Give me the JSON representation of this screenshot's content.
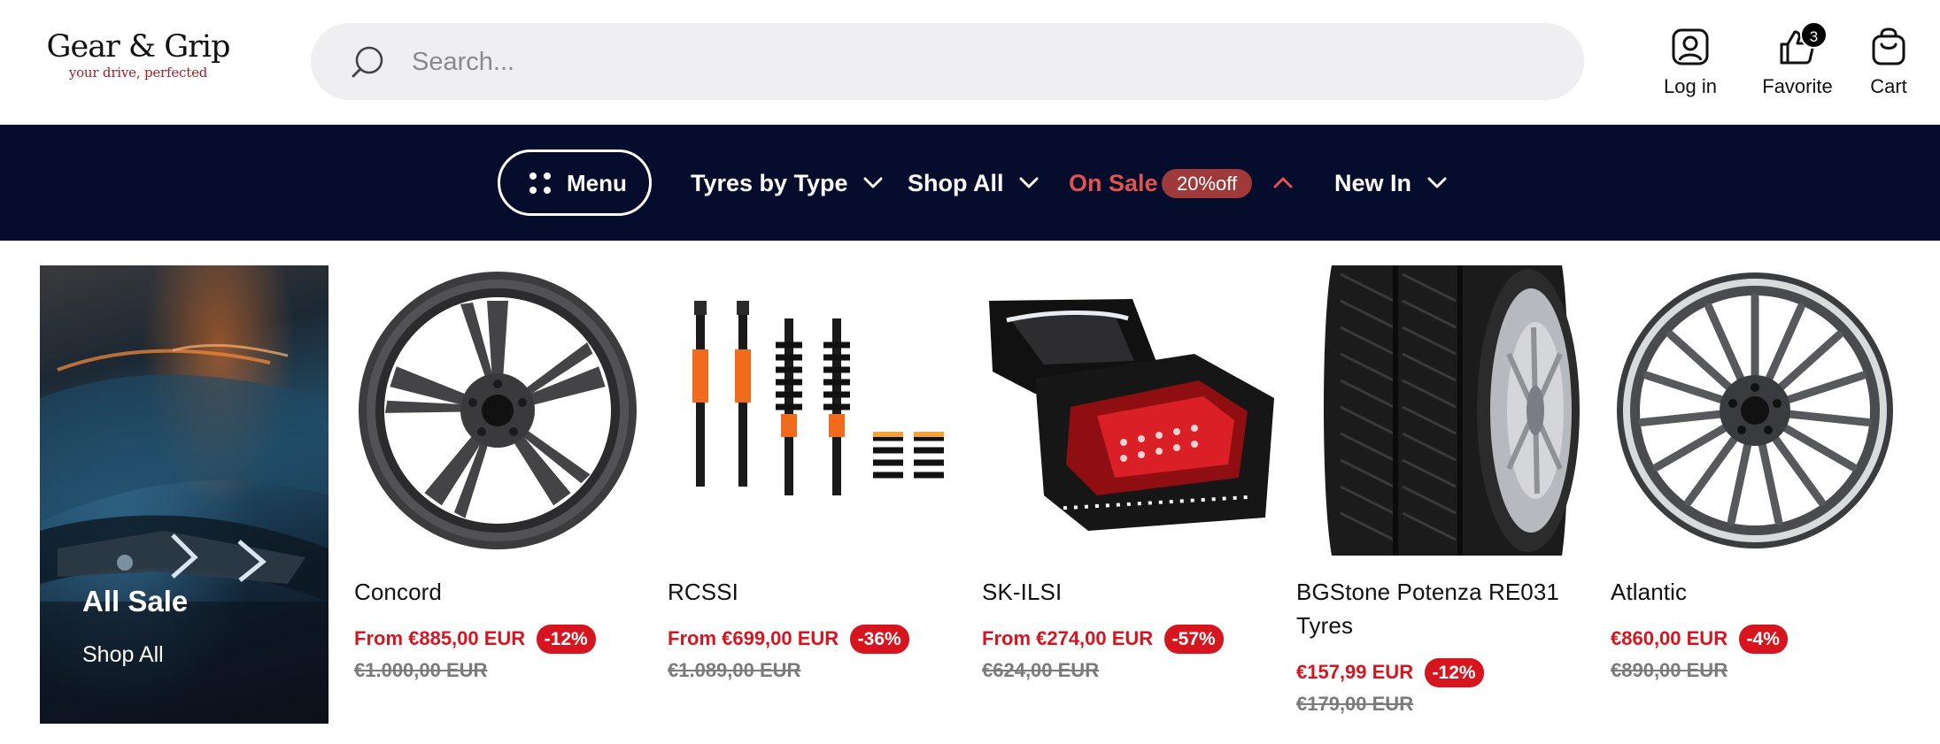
{
  "header": {
    "logo_name": "Gear & Grip",
    "logo_tagline": "your drive, perfected",
    "search_placeholder": "Search...",
    "actions": {
      "login": "Log in",
      "favorite": "Favorite",
      "favorite_count": "3",
      "cart": "Cart"
    }
  },
  "nav": {
    "menu": "Menu",
    "items": {
      "tyres": "Tyres by Type",
      "shop_all": "Shop All",
      "on_sale": "On Sale",
      "sale_badge": "20%off",
      "new_in": "New In"
    },
    "sale_color": "#e1534e"
  },
  "promo": {
    "title": "All Sale",
    "link": "Shop All"
  },
  "products": [
    {
      "name": "Concord",
      "price": "From €885,00 EUR",
      "discount": "-12%",
      "old_price": "€1.000,00 EUR",
      "image_icon": "alloy-wheel-five-spoke"
    },
    {
      "name": "RCSSI",
      "price": "From €699,00 EUR",
      "discount": "-36%",
      "old_price": "€1.089,00 EUR",
      "image_icon": "coilover-kit"
    },
    {
      "name": "SK-ILSI",
      "price": "From €274,00 EUR",
      "discount": "-57%",
      "old_price": "€624,00 EUR",
      "image_icon": "led-tail-lights"
    },
    {
      "name": "BGStone Potenza RE031 Tyres",
      "price": "€157,99 EUR",
      "discount": "-12%",
      "old_price": "€179,00 EUR",
      "image_icon": "tyre-on-wheel"
    },
    {
      "name": "Atlantic",
      "price": "€860,00 EUR",
      "discount": "-4%",
      "old_price": "€890,00 EUR",
      "image_icon": "alloy-wheel-multi-spoke"
    }
  ],
  "colors": {
    "nav_background": "#050c2c",
    "price_red": "#d6151f",
    "sale_pill": "#a0393a",
    "search_background": "#efeff1"
  }
}
